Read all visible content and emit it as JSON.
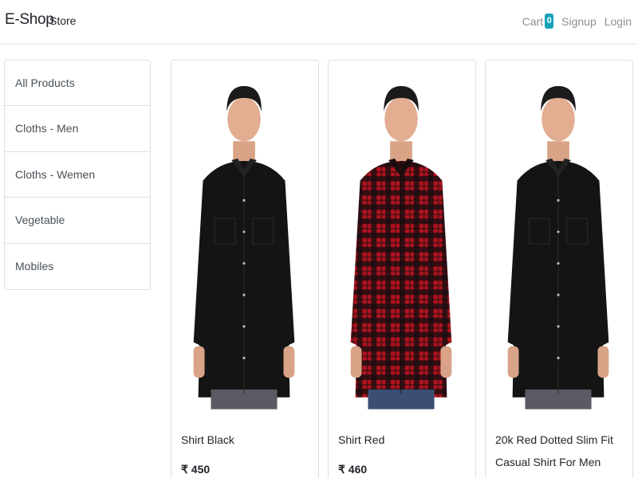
{
  "navbar": {
    "brand": "E-Shop",
    "store_label": "Store",
    "cart_label": "Cart",
    "cart_count": "0",
    "signup_label": "Signup",
    "login_label": "Login"
  },
  "sidebar": {
    "items": [
      {
        "label": "All Products"
      },
      {
        "label": "Cloths - Men"
      },
      {
        "label": "Cloths - Wemen"
      },
      {
        "label": "Vegetable"
      },
      {
        "label": "Mobiles"
      }
    ]
  },
  "products": [
    {
      "title": "Shirt Black",
      "price": "₹ 450",
      "shirt_color": "#141414",
      "check_color": "#141414"
    },
    {
      "title": "Shirt Red",
      "price": "₹ 460",
      "shirt_color": "#b3131f",
      "check_color": "#1a0d10"
    },
    {
      "title": "20k Red Dotted Slim Fit Casual Shirt For Men",
      "price": "",
      "shirt_color": "#141414",
      "check_color": "#141414"
    }
  ],
  "colors": {
    "badge": "#17a2b8",
    "nav_link": "#8a8f95",
    "border": "#dfdfdf"
  }
}
